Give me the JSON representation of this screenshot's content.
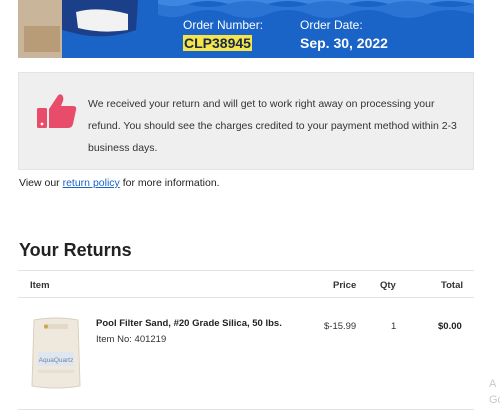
{
  "header": {
    "order_number_label": "Order Number:",
    "order_number": "CLP38945",
    "order_date_label": "Order Date:",
    "order_date": "Sep. 30, 2022",
    "brand_color": "#1a63c7",
    "highlight_color": "#f5e44a"
  },
  "notice": {
    "icon": "thumbs-up-icon",
    "icon_color": "#e84c6a",
    "message": "We received your return and will get to work right away on processing your refund. You should see the charges credited to your payment method within 2-3 business days."
  },
  "policy": {
    "prefix": "View our ",
    "link_text": "return policy",
    "suffix": " for more information."
  },
  "returns": {
    "title": "Your Returns",
    "columns": {
      "item": "Item",
      "price": "Price",
      "qty": "Qty",
      "total": "Total"
    },
    "items": [
      {
        "name": "Pool Filter Sand, #20 Grade Silica, 50 lbs.",
        "item_no": "Item No: 401219",
        "price": "$-15.99",
        "qty": "1",
        "total": "$0.00",
        "image_icon": "sand-bag-icon",
        "bag_brand": "AquaQuartz"
      }
    ]
  },
  "edge_text": [
    "A",
    "Go"
  ]
}
